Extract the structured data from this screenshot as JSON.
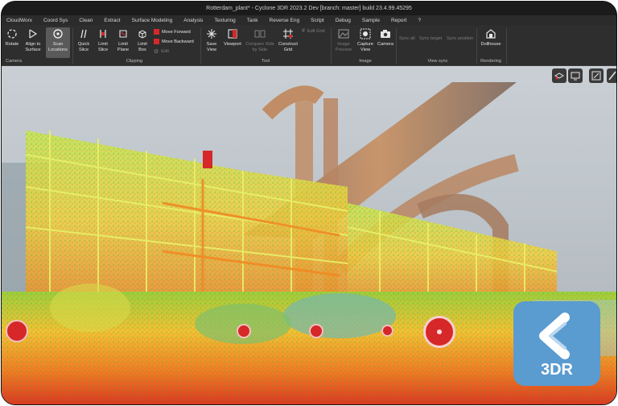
{
  "window": {
    "title": "Rotterdam_plant* - Cyclone 3DR 2023.2 Dev [branch: master] build 23.4.99.45295"
  },
  "menu": {
    "items": [
      "CloudWorx",
      "Coord Sys",
      "Clean",
      "Extract",
      "Surface Modeling",
      "Analysis",
      "Texturing",
      "Tank",
      "Reverse Eng",
      "Script",
      "Debug",
      "Sample",
      "Report",
      "?"
    ]
  },
  "ribbon": {
    "camera": {
      "rotate": "Rotate",
      "align_to_surface": "Align to Surface",
      "scan_locations": "Scan Locations",
      "group": "Camera"
    },
    "clipping": {
      "quick_slice": "Quick Slice",
      "limit_slice": "Limit Slice",
      "limit_plane": "Limit Plane",
      "limit_box": "Limit Box",
      "move_forward": "Move Forward",
      "move_backward": "Move Backward",
      "edit": "Edit",
      "group": "Clipping"
    },
    "tool": {
      "save_view": "Save View",
      "viewport": "Viewport",
      "compare_side_by_side": "Compare Side by Side",
      "construct_grid": "Construct Grid",
      "edit_grid": "Edit Grid",
      "group": "Tool"
    },
    "image": {
      "image_preview": "Image Preview",
      "capture_view": "Capture View",
      "camera": "Camera",
      "group": "Image"
    },
    "view_sync": {
      "sync_all": "Sync all",
      "sync_target": "Sync target",
      "sync_position": "Sync position",
      "group": "View sync"
    },
    "rendering": {
      "dollhouse": "Dollhouse",
      "group": "Rendering"
    }
  },
  "viewport": {
    "scan_markers": 6
  },
  "logo": {
    "text": "3DR",
    "color": "#5a9bd0"
  },
  "colors": {
    "marker_red": "#d62828",
    "ribbon_bg": "#2e2e2e"
  }
}
